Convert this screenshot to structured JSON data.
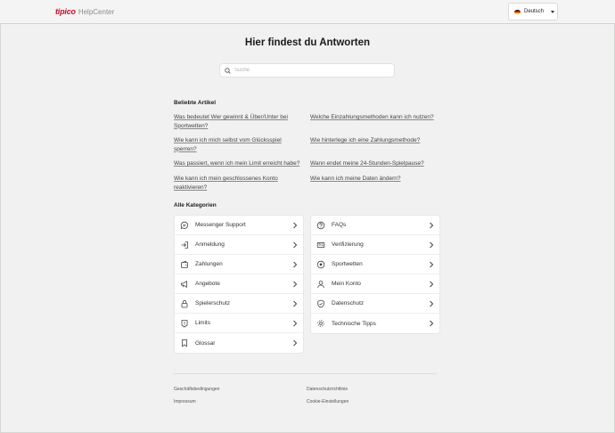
{
  "header": {
    "brand": "tipico",
    "brand_sub": "HelpCenter",
    "language": "Deutsch"
  },
  "main": {
    "title": "Hier findest du Antworten",
    "search_placeholder": "Suche"
  },
  "popular": {
    "label": "Beliebte Artikel",
    "articles": [
      "Was bedeutet Wer gewinnt & Über/Unter bei Sportwetten?",
      "Welche Einzahlungsmethoden kann ich nutzen?",
      "Wie kann ich mich selbst vom Glücksspiel sperren?",
      "Wie hinterlege ich eine Zahlungsmethode?",
      "Was passiert, wenn ich mein Limit erreicht habe?",
      "Wann endet meine 24-Stunden-Spielpause?",
      "Wie kann ich mein geschlossenes Konto reaktivieren?",
      "Wie kann ich meine Daten ändern?"
    ]
  },
  "categories": {
    "label": "Alle Kategorien",
    "left": [
      {
        "label": "Messenger Support",
        "icon": "chat-bubble-icon"
      },
      {
        "label": "Anmeldung",
        "icon": "login-icon"
      },
      {
        "label": "Zahlungen",
        "icon": "wallet-icon"
      },
      {
        "label": "Angebote",
        "icon": "megaphone-icon"
      },
      {
        "label": "Spielerschutz",
        "icon": "lock-icon"
      },
      {
        "label": "Limits",
        "icon": "alert-icon"
      },
      {
        "label": "Glossar",
        "icon": "bookmark-icon"
      }
    ],
    "right": [
      {
        "label": "FAQs",
        "icon": "question-icon"
      },
      {
        "label": "Verifizierung",
        "icon": "id-card-icon"
      },
      {
        "label": "Sportwetten",
        "icon": "football-icon"
      },
      {
        "label": "Mein Konto",
        "icon": "user-icon"
      },
      {
        "label": "Datenschutz",
        "icon": "shield-check-icon"
      },
      {
        "label": "Technische Tipps",
        "icon": "gear-icon"
      }
    ]
  },
  "footer": {
    "links": [
      "Geschäftsbedingungen",
      "Datenschutzrichtlinie",
      "Impressum",
      "Cookie-Einstellungen"
    ]
  },
  "colors": {
    "brand": "#c8102e",
    "background": "#f0f1f0",
    "card": "#ffffff"
  }
}
